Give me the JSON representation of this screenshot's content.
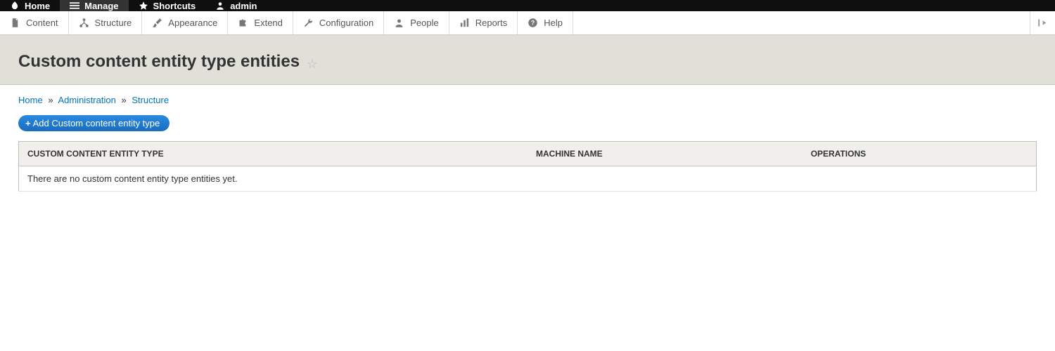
{
  "toolbar": {
    "home": "Home",
    "manage": "Manage",
    "shortcuts": "Shortcuts",
    "user": "admin"
  },
  "admin_menu": {
    "content": "Content",
    "structure": "Structure",
    "appearance": "Appearance",
    "extend": "Extend",
    "configuration": "Configuration",
    "people": "People",
    "reports": "Reports",
    "help": "Help"
  },
  "page": {
    "title": "Custom content entity type entities"
  },
  "breadcrumb": {
    "home": "Home",
    "administration": "Administration",
    "structure": "Structure",
    "sep": "»"
  },
  "actions": {
    "add_label": "Add Custom content entity type"
  },
  "table": {
    "col_name": "CUSTOM CONTENT ENTITY TYPE",
    "col_machine": "MACHINE NAME",
    "col_ops": "OPERATIONS",
    "empty": "There are no custom content entity type entities yet."
  }
}
